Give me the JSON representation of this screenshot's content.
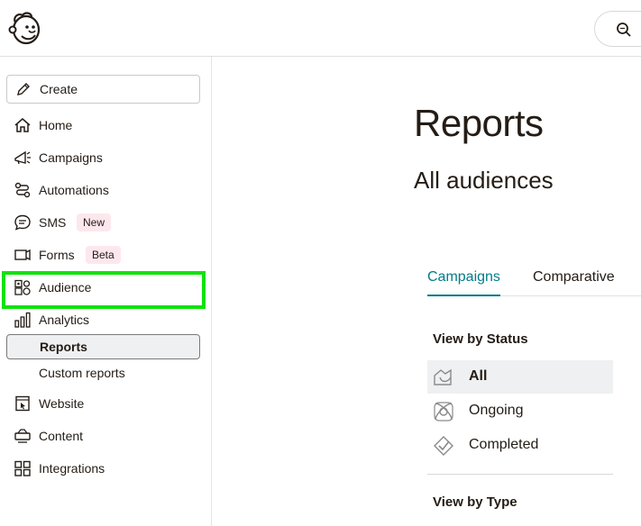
{
  "sidebar": {
    "create_label": "Create",
    "items": [
      {
        "label": "Home"
      },
      {
        "label": "Campaigns"
      },
      {
        "label": "Automations"
      },
      {
        "label": "SMS",
        "badge": "New"
      },
      {
        "label": "Forms",
        "badge": "Beta"
      },
      {
        "label": "Audience"
      },
      {
        "label": "Analytics"
      }
    ],
    "analytics_sub": [
      {
        "label": "Reports",
        "active": true
      },
      {
        "label": "Custom reports"
      }
    ],
    "items_after": [
      {
        "label": "Website"
      },
      {
        "label": "Content"
      },
      {
        "label": "Integrations"
      }
    ]
  },
  "main": {
    "title": "Reports",
    "audience": "All audiences",
    "tabs": [
      {
        "label": "Campaigns",
        "active": true
      },
      {
        "label": "Comparative"
      }
    ],
    "view_by_status": {
      "heading": "View by Status",
      "items": [
        {
          "label": "All",
          "selected": true,
          "icon": "all-campaigns-icon"
        },
        {
          "label": "Ongoing",
          "icon": "ongoing-icon"
        },
        {
          "label": "Completed",
          "icon": "completed-icon"
        }
      ]
    },
    "view_by_type": {
      "heading": "View by Type"
    }
  },
  "colors": {
    "accent": "#007c89",
    "highlight": "#11e20e",
    "badge_bg": "#fde7ee",
    "selected_bg": "#eef0f1"
  }
}
